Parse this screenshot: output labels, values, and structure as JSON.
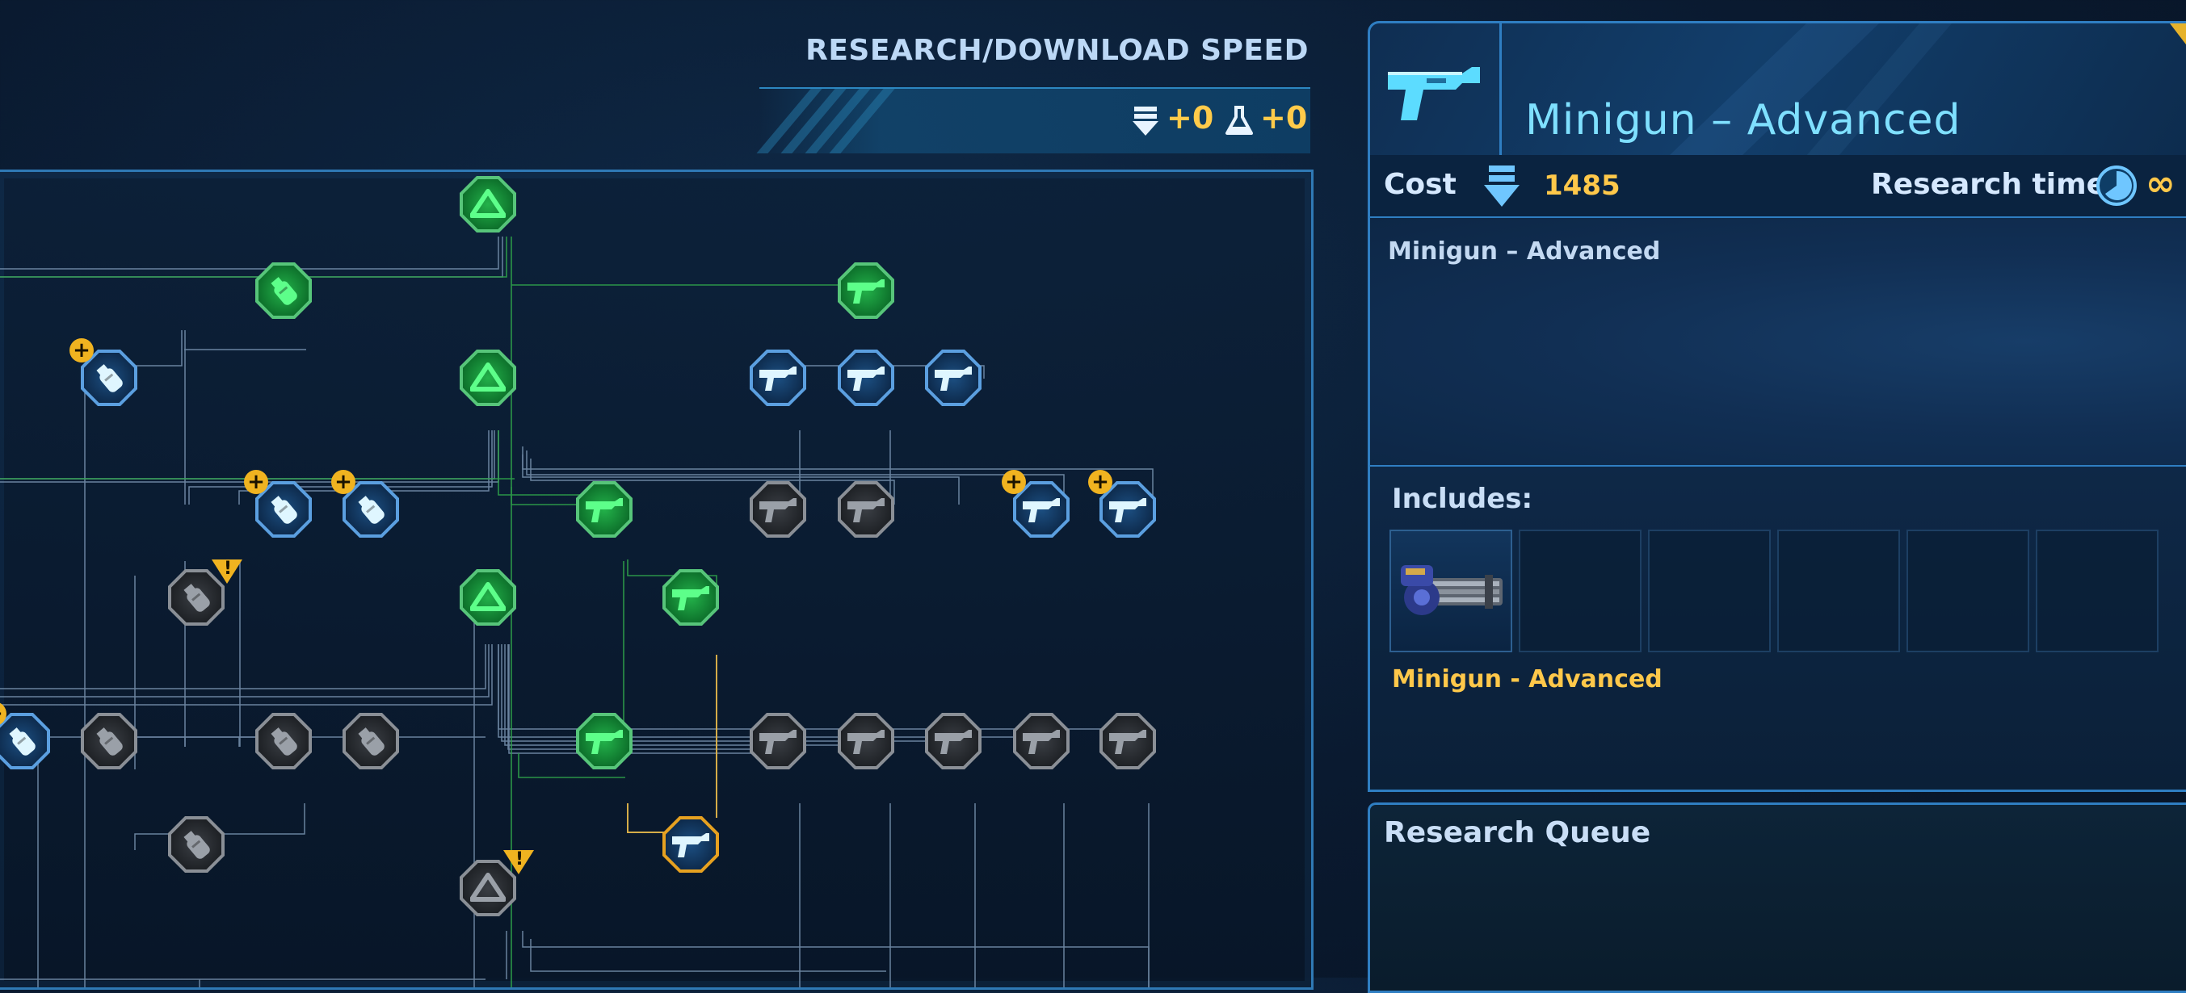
{
  "header": {
    "speed_title": "RESEARCH/DOWNLOAD SPEED",
    "download_bonus": "+0",
    "research_bonus": "+0",
    "download_icon": "download-arrow-icon",
    "research_icon": "flask-icon"
  },
  "detail": {
    "item_icon": "blaster-icon",
    "title": "Minigun – Advanced",
    "cost_label": "Cost",
    "cost_icon": "download-arrow-icon",
    "cost_value": "1485",
    "research_time_label": "Research time",
    "research_time_icon": "clock-icon",
    "research_time_value": "∞",
    "description": "Minigun – Advanced",
    "includes_label": "Includes:",
    "includes_items": [
      "Minigun - Advanced"
    ],
    "includes_image_icon": "minigun-icon",
    "queue_title": "Research Queue"
  },
  "colors": {
    "accent_blue": "#2f7ec2",
    "gold": "#ffc84a",
    "researched_green": "#23b24a",
    "available_blue": "#5b9fe0",
    "locked_gray": "#8a8f96",
    "selected_orange": "#e6a120"
  },
  "tree": {
    "nodes": [
      {
        "id": "n1",
        "icon": "chevron-up-icon",
        "state": "green"
      },
      {
        "id": "n2",
        "icon": "grenade-icon",
        "state": "green"
      },
      {
        "id": "n3",
        "icon": "blaster-icon",
        "state": "green"
      },
      {
        "id": "n4",
        "icon": "grenade-icon",
        "state": "blue",
        "badge": "plus"
      },
      {
        "id": "n5",
        "icon": "chevron-up-icon",
        "state": "green"
      },
      {
        "id": "n6",
        "icon": "blaster-icon",
        "state": "blue"
      },
      {
        "id": "n7",
        "icon": "blaster-icon",
        "state": "blue"
      },
      {
        "id": "n8",
        "icon": "blaster-icon",
        "state": "blue"
      },
      {
        "id": "n9",
        "icon": "grenade-icon",
        "state": "blue",
        "badge": "plus"
      },
      {
        "id": "n10",
        "icon": "grenade-icon",
        "state": "blue",
        "badge": "plus"
      },
      {
        "id": "n11",
        "icon": "blaster-icon",
        "state": "green"
      },
      {
        "id": "n12",
        "icon": "blaster-icon",
        "state": "gray"
      },
      {
        "id": "n13",
        "icon": "blaster-icon",
        "state": "gray"
      },
      {
        "id": "n14",
        "icon": "blaster-icon",
        "state": "blue",
        "badge": "plus"
      },
      {
        "id": "n15",
        "icon": "blaster-icon",
        "state": "blue",
        "badge": "plus"
      },
      {
        "id": "n16",
        "icon": "grenade-icon",
        "state": "gray",
        "badge": "warn"
      },
      {
        "id": "n17",
        "icon": "chevron-up-icon",
        "state": "green"
      },
      {
        "id": "n18",
        "icon": "blaster-icon",
        "state": "green"
      },
      {
        "id": "n19",
        "icon": "grenade-icon",
        "state": "blue",
        "badge": "plus"
      },
      {
        "id": "n20",
        "icon": "grenade-icon",
        "state": "gray"
      },
      {
        "id": "n21",
        "icon": "grenade-icon",
        "state": "gray"
      },
      {
        "id": "n22",
        "icon": "grenade-icon",
        "state": "gray"
      },
      {
        "id": "n23",
        "icon": "blaster-icon",
        "state": "green"
      },
      {
        "id": "n24",
        "icon": "blaster-icon",
        "state": "gray"
      },
      {
        "id": "n25",
        "icon": "blaster-icon",
        "state": "gray"
      },
      {
        "id": "n26",
        "icon": "blaster-icon",
        "state": "gray"
      },
      {
        "id": "n27",
        "icon": "blaster-icon",
        "state": "gray"
      },
      {
        "id": "n28",
        "icon": "blaster-icon",
        "state": "gray"
      },
      {
        "id": "n29",
        "icon": "grenade-icon",
        "state": "gray"
      },
      {
        "id": "n30",
        "icon": "chevron-up-icon",
        "state": "gray",
        "badge": "warn"
      },
      {
        "id": "n31",
        "icon": "blaster-icon",
        "state": "orange",
        "selected": true
      }
    ]
  }
}
